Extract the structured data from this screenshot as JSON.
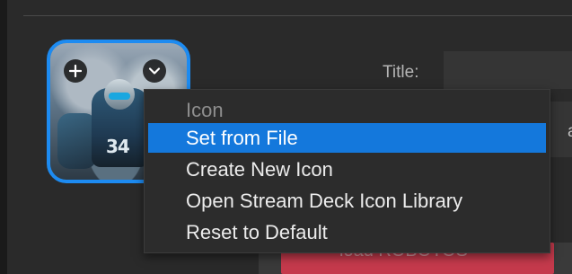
{
  "header": {
    "title_label": "Title:"
  },
  "right_panel": {
    "partial_char": "a",
    "preview_text": "load ROBOTOS"
  },
  "icon_tile": {
    "add_symbol": "+",
    "menu_symbol": "⌄",
    "art_number": "34",
    "accent_color": "#1d8bf1"
  },
  "context_menu": {
    "header": "Icon",
    "items": [
      {
        "label": "Set from File",
        "selected": true
      },
      {
        "label": "Create New Icon",
        "selected": false
      },
      {
        "label": "Open Stream Deck Icon Library",
        "selected": false
      },
      {
        "label": "Reset to Default",
        "selected": false
      }
    ],
    "highlight_color": "#1478dc"
  }
}
